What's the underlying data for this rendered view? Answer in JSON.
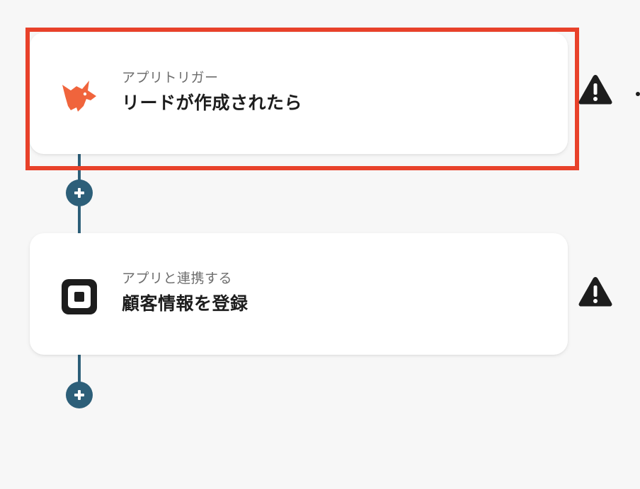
{
  "colors": {
    "connector": "#2d5f79",
    "highlight": "#e8412a",
    "fox_icon": "#f0643c",
    "square_icon": "#1d1d1d",
    "warning": "#1d1d1d"
  },
  "flow": {
    "steps": [
      {
        "subtitle": "アプリトリガー",
        "title": "リードが作成されたら",
        "icon": "fox-icon",
        "status_icon": "warning-icon",
        "highlighted": true
      },
      {
        "subtitle": "アプリと連携する",
        "title": "顧客情報を登録",
        "icon": "square-icon",
        "status_icon": "warning-icon",
        "highlighted": false
      }
    ],
    "add_step_icon": "plus-icon"
  }
}
